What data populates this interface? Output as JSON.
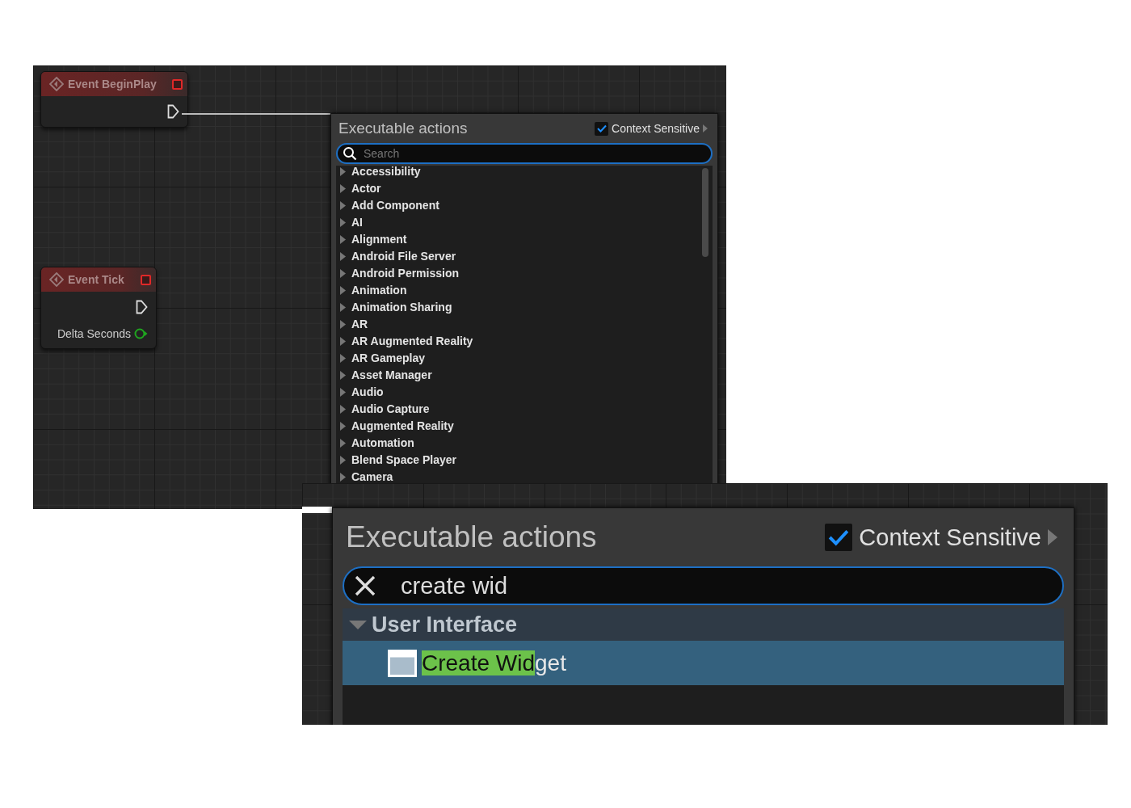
{
  "graph": {
    "nodes": [
      {
        "title": "Event BeginPlay",
        "kind": "exec"
      },
      {
        "title": "Event Tick",
        "kind": "exec_with_output",
        "output_label": "Delta Seconds"
      }
    ]
  },
  "action_menu": {
    "title": "Executable actions",
    "context_sensitive": {
      "label": "Context Sensitive",
      "checked": true
    },
    "search": {
      "placeholder": "Search"
    },
    "categories": [
      {
        "label": "Accessibility",
        "expanded": false
      },
      {
        "label": "Actor",
        "expanded": false
      },
      {
        "label": "Add Component",
        "expanded": false
      },
      {
        "label": "AI",
        "expanded": false
      },
      {
        "label": "Alignment",
        "expanded": false
      },
      {
        "label": "Android File Server",
        "expanded": false
      },
      {
        "label": "Android Permission",
        "expanded": false
      },
      {
        "label": "Animation",
        "expanded": false
      },
      {
        "label": "Animation Sharing",
        "expanded": false
      },
      {
        "label": "AR",
        "expanded": false
      },
      {
        "label": "AR Augmented Reality",
        "expanded": false
      },
      {
        "label": "AR Gameplay",
        "expanded": false
      },
      {
        "label": "Asset Manager",
        "expanded": false
      },
      {
        "label": "Audio",
        "expanded": false
      },
      {
        "label": "Audio Capture",
        "expanded": false
      },
      {
        "label": "Augmented Reality",
        "expanded": false
      },
      {
        "label": "Automation",
        "expanded": false
      },
      {
        "label": "Blend Space Player",
        "expanded": false
      },
      {
        "label": "Camera",
        "expanded": false
      }
    ]
  },
  "zoomed_menu": {
    "title": "Executable actions",
    "context_sensitive": {
      "label": "Context Sensitive",
      "checked": true
    },
    "search": {
      "value": "create wid"
    },
    "categories": [
      {
        "label": "User Interface",
        "expanded": true,
        "children": [
          {
            "label_match": "Create Wid",
            "label_rest": "get",
            "selected": true
          }
        ]
      }
    ]
  }
}
